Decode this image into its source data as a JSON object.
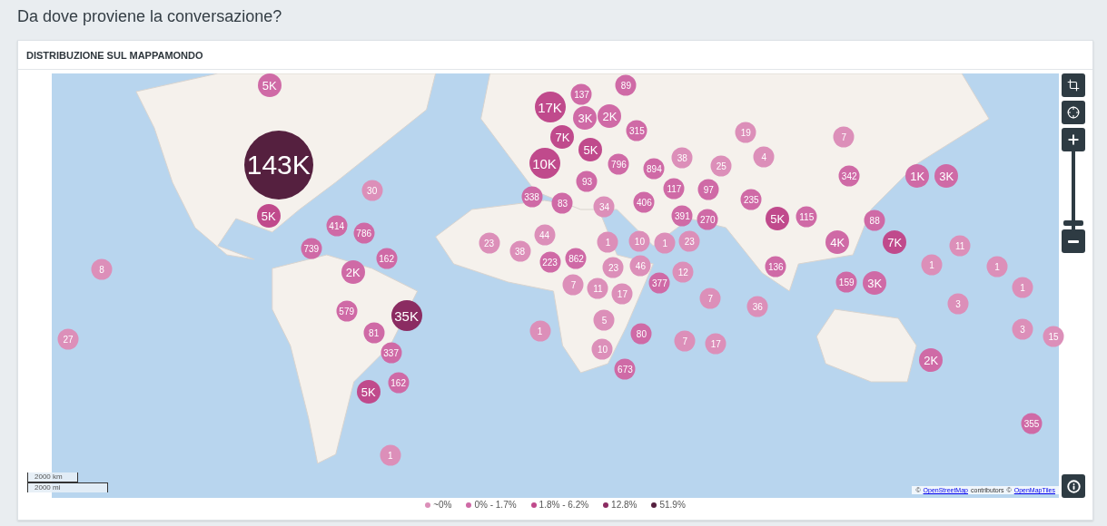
{
  "page_title": "Da dove proviene la conversazione?",
  "card": {
    "title": "DISTRIBUZIONE SUL MAPPAMONDO",
    "map": {
      "markers": [
        {
          "label": "5K",
          "color": "#cf6aa6"
        },
        {
          "label": "143K",
          "color": "#55203f"
        },
        {
          "label": "30",
          "color": "#dc8fb9"
        },
        {
          "label": "5K",
          "color": "#c04a8c"
        },
        {
          "label": "414",
          "color": "#cf6aa6"
        },
        {
          "label": "786",
          "color": "#cf6aa6"
        },
        {
          "label": "739",
          "color": "#cf6aa6"
        },
        {
          "label": "162",
          "color": "#cf6aa6"
        },
        {
          "label": "8",
          "color": "#dc8fb9"
        },
        {
          "label": "2K",
          "color": "#cf6aa6"
        },
        {
          "label": "579",
          "color": "#cf6aa6"
        },
        {
          "label": "35K",
          "color": "#8b2c62"
        },
        {
          "label": "81",
          "color": "#cf6aa6"
        },
        {
          "label": "337",
          "color": "#cf6aa6"
        },
        {
          "label": "162",
          "color": "#cf6aa6"
        },
        {
          "label": "5K",
          "color": "#c04a8c"
        },
        {
          "label": "1",
          "color": "#dc8fb9"
        },
        {
          "label": "27",
          "color": "#dc8fb9"
        },
        {
          "label": "17K",
          "color": "#c04a8c"
        },
        {
          "label": "137",
          "color": "#cf6aa6"
        },
        {
          "label": "89",
          "color": "#cf6aa6"
        },
        {
          "label": "3K",
          "color": "#cf6aa6"
        },
        {
          "label": "2K",
          "color": "#cf6aa6"
        },
        {
          "label": "7K",
          "color": "#c04a8c"
        },
        {
          "label": "315",
          "color": "#cf6aa6"
        },
        {
          "label": "5K",
          "color": "#c04a8c"
        },
        {
          "label": "10K",
          "color": "#c04a8c"
        },
        {
          "label": "796",
          "color": "#cf6aa6"
        },
        {
          "label": "894",
          "color": "#cf6aa6"
        },
        {
          "label": "93",
          "color": "#cf6aa6"
        },
        {
          "label": "338",
          "color": "#cf6aa6"
        },
        {
          "label": "83",
          "color": "#cf6aa6"
        },
        {
          "label": "34",
          "color": "#dc8fb9"
        },
        {
          "label": "406",
          "color": "#cf6aa6"
        },
        {
          "label": "117",
          "color": "#cf6aa6"
        },
        {
          "label": "97",
          "color": "#cf6aa6"
        },
        {
          "label": "391",
          "color": "#cf6aa6"
        },
        {
          "label": "270",
          "color": "#cf6aa6"
        },
        {
          "label": "44",
          "color": "#dc8fb9"
        },
        {
          "label": "23",
          "color": "#dc8fb9"
        },
        {
          "label": "38",
          "color": "#dc8fb9"
        },
        {
          "label": "223",
          "color": "#cf6aa6"
        },
        {
          "label": "862",
          "color": "#cf6aa6"
        },
        {
          "label": "1",
          "color": "#dc8fb9"
        },
        {
          "label": "10",
          "color": "#dc8fb9"
        },
        {
          "label": "1",
          "color": "#dc8fb9"
        },
        {
          "label": "23",
          "color": "#dc8fb9"
        },
        {
          "label": "23",
          "color": "#dc8fb9"
        },
        {
          "label": "46",
          "color": "#dc8fb9"
        },
        {
          "label": "12",
          "color": "#dc8fb9"
        },
        {
          "label": "7",
          "color": "#dc8fb9"
        },
        {
          "label": "11",
          "color": "#dc8fb9"
        },
        {
          "label": "17",
          "color": "#dc8fb9"
        },
        {
          "label": "377",
          "color": "#cf6aa6"
        },
        {
          "label": "7",
          "color": "#dc8fb9"
        },
        {
          "label": "36",
          "color": "#dc8fb9"
        },
        {
          "label": "5",
          "color": "#dc8fb9"
        },
        {
          "label": "80",
          "color": "#cf6aa6"
        },
        {
          "label": "10",
          "color": "#dc8fb9"
        },
        {
          "label": "7",
          "color": "#dc8fb9"
        },
        {
          "label": "17",
          "color": "#dc8fb9"
        },
        {
          "label": "673",
          "color": "#cf6aa6"
        },
        {
          "label": "1",
          "color": "#dc8fb9"
        },
        {
          "label": "38",
          "color": "#dc8fb9"
        },
        {
          "label": "25",
          "color": "#dc8fb9"
        },
        {
          "label": "19",
          "color": "#dc8fb9"
        },
        {
          "label": "4",
          "color": "#dc8fb9"
        },
        {
          "label": "235",
          "color": "#cf6aa6"
        },
        {
          "label": "5K",
          "color": "#c04a8c"
        },
        {
          "label": "115",
          "color": "#cf6aa6"
        },
        {
          "label": "7",
          "color": "#dc8fb9"
        },
        {
          "label": "342",
          "color": "#cf6aa6"
        },
        {
          "label": "1K",
          "color": "#cf6aa6"
        },
        {
          "label": "3K",
          "color": "#cf6aa6"
        },
        {
          "label": "88",
          "color": "#cf6aa6"
        },
        {
          "label": "4K",
          "color": "#cf6aa6"
        },
        {
          "label": "7K",
          "color": "#c04a8c"
        },
        {
          "label": "11",
          "color": "#dc8fb9"
        },
        {
          "label": "136",
          "color": "#cf6aa6"
        },
        {
          "label": "1",
          "color": "#dc8fb9"
        },
        {
          "label": "1",
          "color": "#dc8fb9"
        },
        {
          "label": "159",
          "color": "#cf6aa6"
        },
        {
          "label": "3K",
          "color": "#cf6aa6"
        },
        {
          "label": "1",
          "color": "#dc8fb9"
        },
        {
          "label": "3",
          "color": "#dc8fb9"
        },
        {
          "label": "3",
          "color": "#dc8fb9"
        },
        {
          "label": "15",
          "color": "#dc8fb9"
        },
        {
          "label": "2K",
          "color": "#cf6aa6"
        },
        {
          "label": "355",
          "color": "#cf6aa6"
        }
      ],
      "scale": [
        "2000 km",
        "2000 mi"
      ],
      "attribution": [
        {
          "kind": "text",
          "text": "©"
        },
        {
          "kind": "link",
          "text": "OpenStreetMap"
        },
        {
          "kind": "text",
          "text": "contributors"
        },
        {
          "kind": "text",
          "text": "©"
        },
        {
          "kind": "link",
          "text": "OpenMapTiles"
        }
      ],
      "zoom_slider": {
        "level": 0.05
      }
    },
    "legend": [
      {
        "label": "~0%",
        "color": "#dc8fb9"
      },
      {
        "label": "0% - 1.7%",
        "color": "#cf6aa6"
      },
      {
        "label": "1.8% - 6.2%",
        "color": "#c04a8c"
      },
      {
        "label": "12.8%",
        "color": "#8b2c62"
      },
      {
        "label": "51.9%",
        "color": "#55203f"
      }
    ]
  }
}
